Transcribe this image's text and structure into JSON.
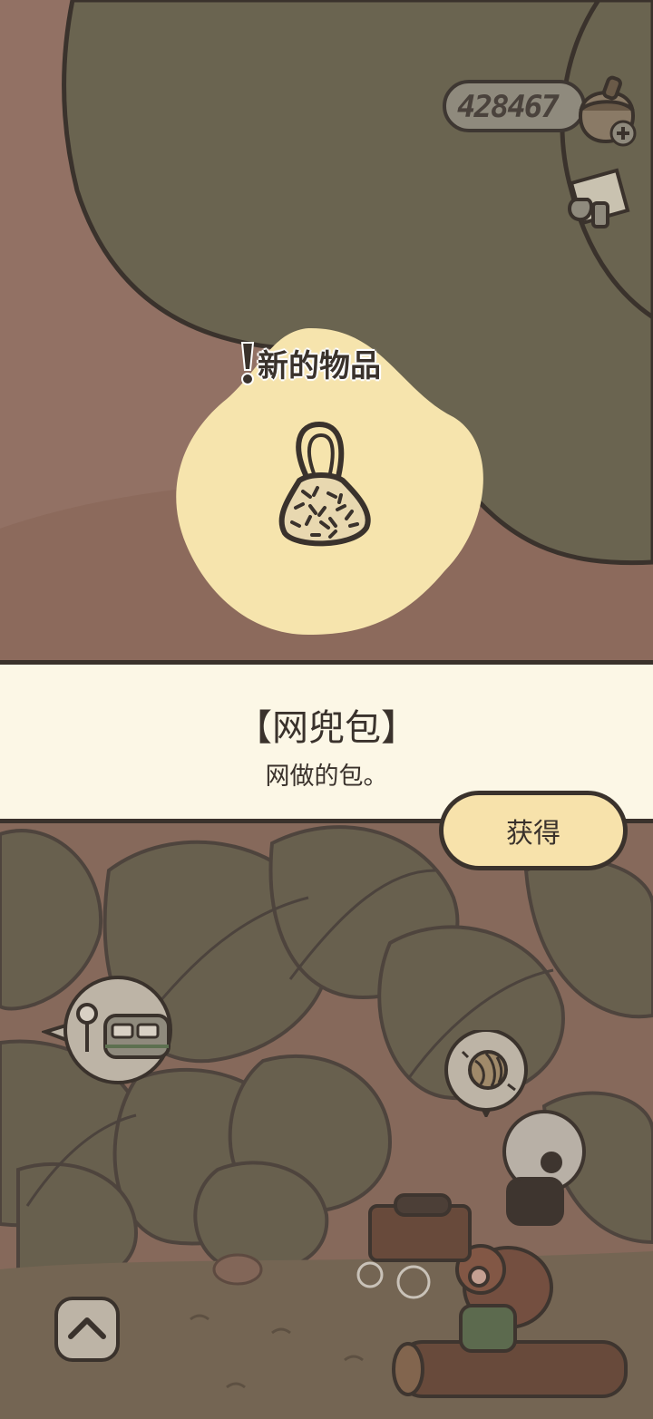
{
  "game": {
    "currency": {
      "amount": "428467",
      "icon": "acorn-icon",
      "add_icon": "plus-icon"
    },
    "mail_icon": "letter-icon",
    "new_item": {
      "label": "新的物品",
      "alert_icon": "exclamation-icon",
      "item_icon": "net-bag-icon"
    },
    "item_info": {
      "name": "【网兜包】",
      "description": "网做的包。"
    },
    "obtain_button": "获得",
    "bubbles": [
      {
        "icon": "train-station-icon"
      },
      {
        "icon": "yarn-ball-icon"
      }
    ],
    "up_button_icon": "chevron-up-icon"
  },
  "colors": {
    "background": "#927164",
    "foliage": "#6a6450",
    "banner": "#fcf7e6",
    "highlight": "#f6e4ad",
    "button": "#f7e2ab",
    "outline": "#3a322c"
  }
}
